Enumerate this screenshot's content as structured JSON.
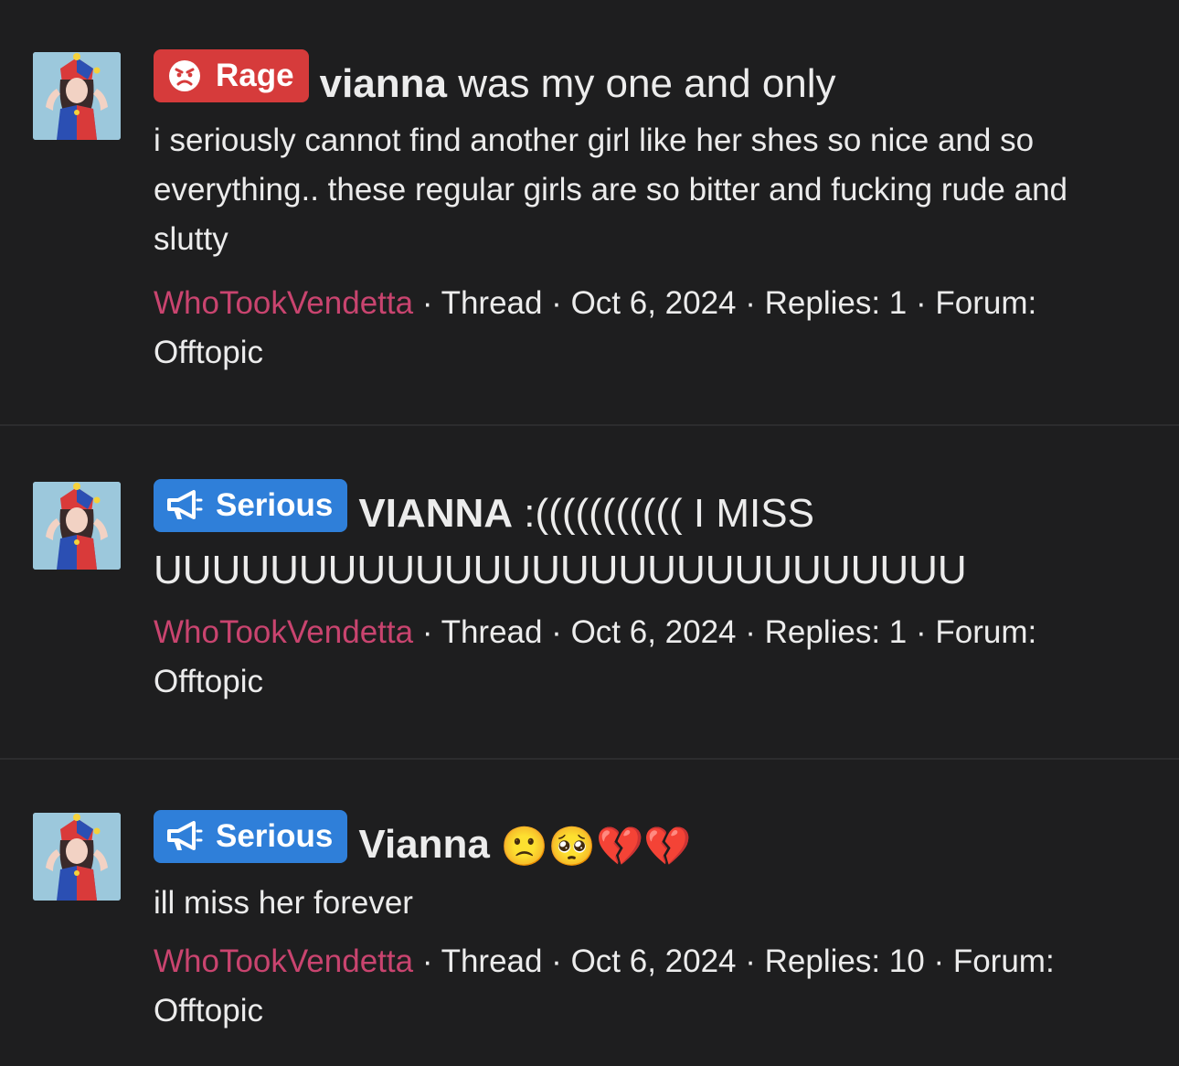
{
  "threads": [
    {
      "prefix": "Rage",
      "prefix_icon": "angry-face-icon",
      "prefix_color": "#d63b3b",
      "title_bold": "vianna",
      "title_rest": " was my one and only",
      "body": "i seriously cannot find another girl like her shes so nice and so everything.. these regular girls are so bitter and fucking rude and slutty",
      "author": "WhoTookVendetta",
      "meta_rest": " · Thread · Oct 6, 2024 · Replies: 1 · Forum: Offtopic"
    },
    {
      "prefix": "Serious",
      "prefix_icon": "megaphone-icon",
      "prefix_color": "#2f7fd9",
      "title_bold": "VIANNA",
      "title_rest": " :((((((((((( I MISS UUUUUUUUUUUUUUUUUUUUUUUUUUUU",
      "author": "WhoTookVendetta",
      "meta_rest": " · Thread · Oct 6, 2024 · Replies: 1 · Forum: Offtopic"
    },
    {
      "prefix": "Serious",
      "prefix_icon": "megaphone-icon",
      "prefix_color": "#2f7fd9",
      "title_bold": "Vianna",
      "title_emojis": " 🙁🥺💔💔",
      "body": "ill miss her forever",
      "author": "WhoTookVendetta",
      "meta_rest": " · Thread · Oct 6, 2024 · Replies: 10 · Forum: Offtopic"
    }
  ],
  "colors": {
    "background": "#1e1e1f",
    "author": "#c9446f",
    "text": "#ececec"
  }
}
